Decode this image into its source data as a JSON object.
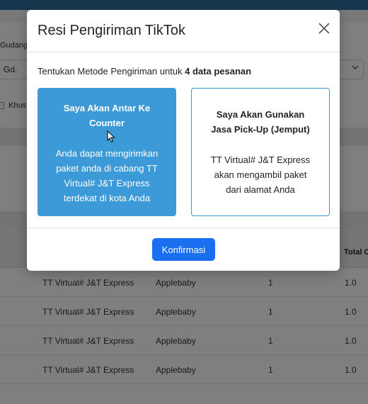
{
  "background": {
    "gudang_label": "Gudang",
    "gudang_value": "Gd.",
    "khus_label": "Khus",
    "table_header_total": "Total C",
    "rows": [
      {
        "kurir": "TT Virtual# J&T Express",
        "toko": "Applebaby",
        "qty": "1",
        "total": "1.0"
      },
      {
        "kurir": "TT Virtual# J&T Express",
        "toko": "Applebaby",
        "qty": "1",
        "total": "1.0"
      },
      {
        "kurir": "TT Virtual# J&T Express",
        "toko": "Applebaby",
        "qty": "1",
        "total": "1.0"
      },
      {
        "kurir": "TT Virtual# J&T Express",
        "toko": "Applebaby",
        "qty": "1",
        "total": "1.0"
      }
    ]
  },
  "modal": {
    "title": "Resi Pengiriman TikTok",
    "instruction_prefix": "Tentukan Metode Pengiriman untuk ",
    "instruction_count": "4 data pesanan",
    "options": [
      {
        "title_line1": "Saya Akan Antar Ke",
        "title_line2": "Counter",
        "desc_lines": [
          "Anda dapat mengirimkan",
          "paket anda di cabang TT",
          "Virtual# J&T Express",
          "terdekat di kota Anda"
        ]
      },
      {
        "title_line1": "Saya Akan Gunakan",
        "title_line2": "Jasa Pick-Up (Jemput)",
        "desc_lines": [
          "TT Virtual# J&T Express",
          "akan mengambil paket",
          "dari alamat Anda"
        ]
      }
    ],
    "confirm_label": "Konfirmasi"
  },
  "colors": {
    "option_selected": "#3d9ad8",
    "confirm_button": "#1a6ff0",
    "topbar": "#2f6f9e"
  },
  "icons": {
    "close": "close-icon",
    "cursor": "mouse-cursor-icon",
    "dropdown": "chevron-down-icon"
  }
}
